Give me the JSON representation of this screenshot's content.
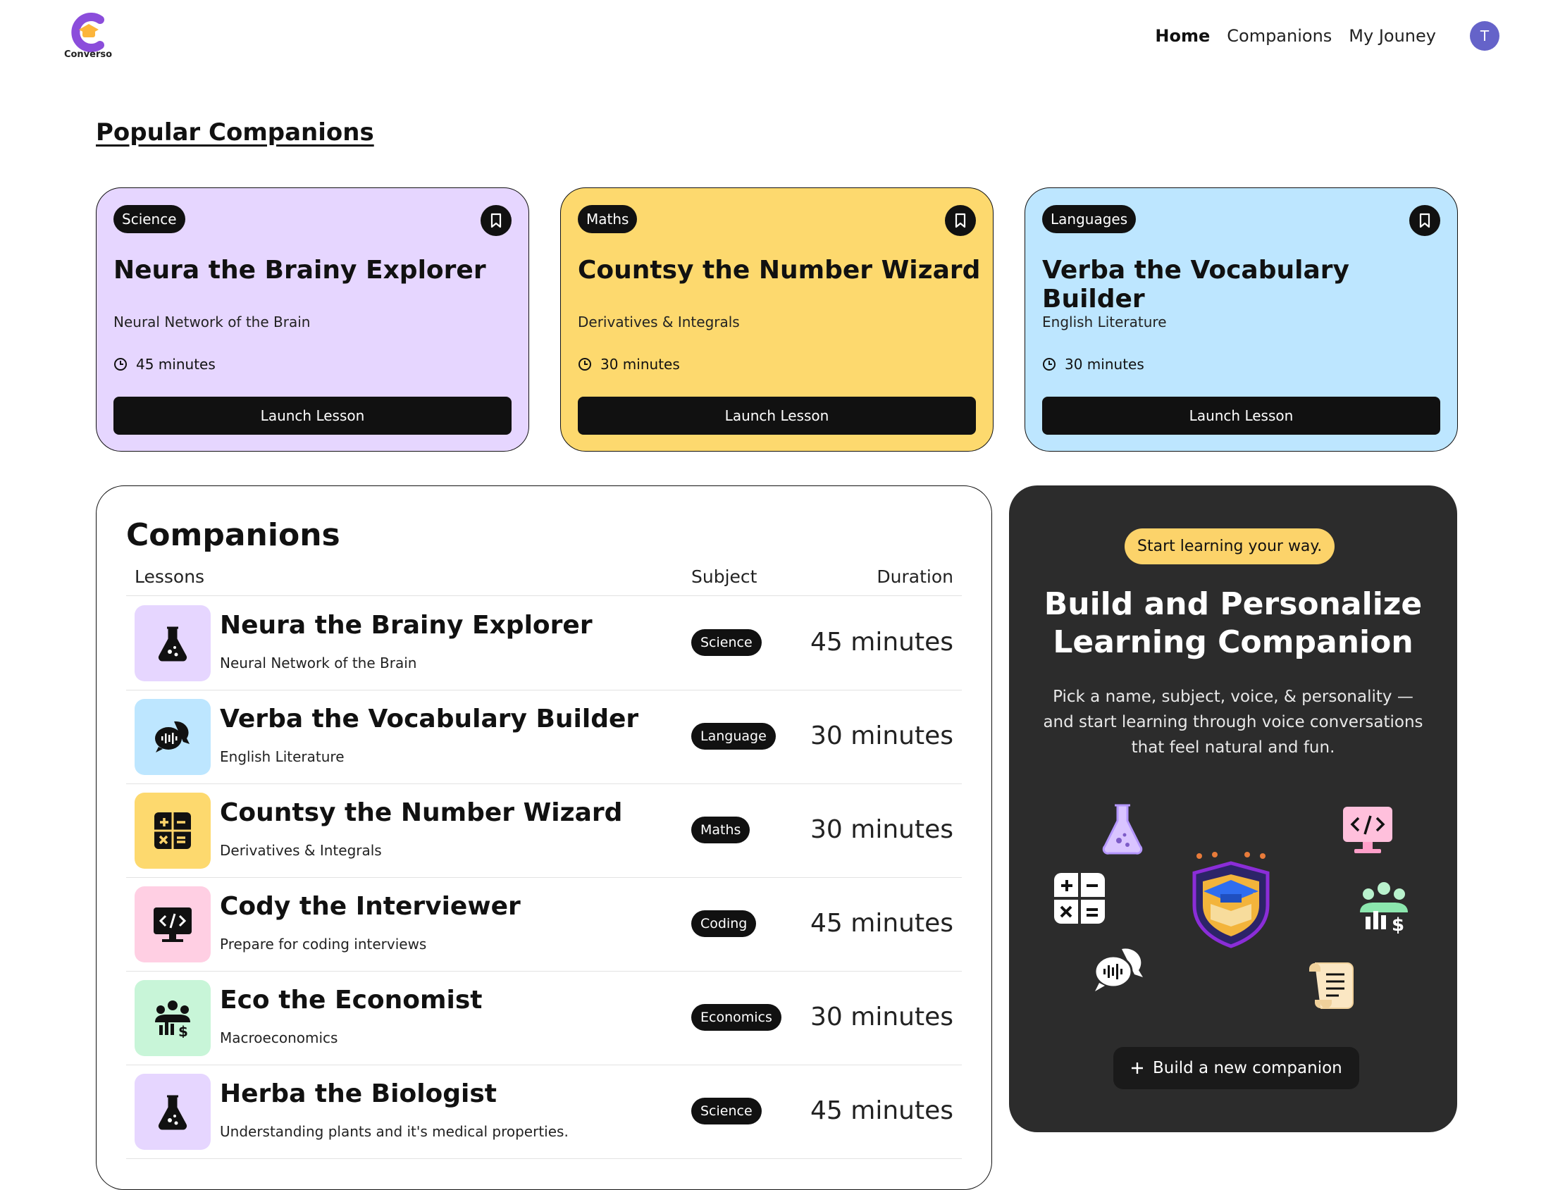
{
  "nav": {
    "logo_text": "Converso",
    "links": [
      {
        "label": "Home",
        "active": true
      },
      {
        "label": "Companions",
        "active": false
      },
      {
        "label": "My Jouney",
        "active": false
      }
    ],
    "avatar_initial": "T"
  },
  "popular": {
    "title": "Popular Companions",
    "cards": [
      {
        "subject": "Science",
        "title": "Neura the Brainy Explorer",
        "topic": "Neural Network of the Brain",
        "duration": "45 minutes",
        "button": "Launch Lesson",
        "color": "#e6d6ff"
      },
      {
        "subject": "Maths",
        "title": "Countsy the Number Wizard",
        "topic": "Derivatives & Integrals",
        "duration": "30 minutes",
        "button": "Launch Lesson",
        "color": "#fdd96e"
      },
      {
        "subject": "Languages",
        "title": "Verba the Vocabulary Builder",
        "topic": "English Literature",
        "duration": "30 minutes",
        "button": "Launch Lesson",
        "color": "#bde6ff"
      }
    ]
  },
  "companions": {
    "title": "Companions",
    "headers": {
      "lessons": "Lessons",
      "subject": "Subject",
      "duration": "Duration"
    },
    "rows": [
      {
        "name": "Neura the Brainy Explorer",
        "topic": "Neural Network of the Brain",
        "subject": "Science",
        "duration": "45 minutes",
        "icon": "flask-icon",
        "color": "#e6d6ff"
      },
      {
        "name": "Verba the Vocabulary Builder",
        "topic": "English Literature",
        "subject": "Language",
        "duration": "30 minutes",
        "icon": "chat-bubble-icon",
        "color": "#bde6ff"
      },
      {
        "name": "Countsy the Number Wizard",
        "topic": "Derivatives & Integrals",
        "subject": "Maths",
        "duration": "30 minutes",
        "icon": "calculator-icon",
        "color": "#fdd96e"
      },
      {
        "name": "Cody the Interviewer",
        "topic": "Prepare for coding interviews",
        "subject": "Coding",
        "duration": "45 minutes",
        "icon": "code-monitor-icon",
        "color": "#ffcfe3"
      },
      {
        "name": "Eco the Economist",
        "topic": "Macroeconomics",
        "subject": "Economics",
        "duration": "30 minutes",
        "icon": "economy-group-icon",
        "color": "#c8f5d8"
      },
      {
        "name": "Herba the Biologist",
        "topic": "Understanding plants and it's medical properties.",
        "subject": "Science",
        "duration": "45 minutes",
        "icon": "flask-icon",
        "color": "#e6d6ff"
      }
    ]
  },
  "cta": {
    "pill": "Start learning your way.",
    "headline_line1": "Build and Personalize",
    "headline_line2": "Learning Companion",
    "description": "Pick a name, subject, voice, & personality — and start learning through voice conversations that feel natural and fun.",
    "button": "Build a new companion",
    "accent": "#fcd36a"
  }
}
